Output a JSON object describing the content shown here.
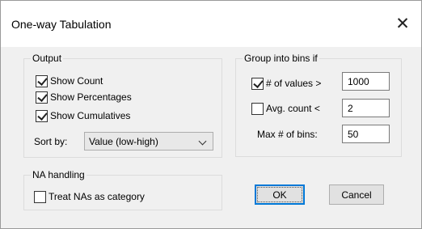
{
  "window": {
    "title": "One-way Tabulation",
    "close_glyph": "✕"
  },
  "output": {
    "legend": "Output",
    "show_count": {
      "label": "Show Count",
      "checked": true
    },
    "show_percentages": {
      "label": "Show Percentages",
      "checked": true
    },
    "show_cumulatives": {
      "label": "Show Cumulatives",
      "checked": true
    },
    "sort_by_label": "Sort by:",
    "sort_by_value": "Value (low-high)"
  },
  "bins": {
    "legend": "Group into bins if",
    "num_values": {
      "label": "# of values >",
      "checked": true,
      "value": "1000"
    },
    "avg_count": {
      "label": "Avg. count <",
      "checked": false,
      "value": "2"
    },
    "max_bins_label": "Max # of bins:",
    "max_bins_value": "50"
  },
  "na": {
    "legend": "NA handling",
    "treat_nas": {
      "label": "Treat NAs as category",
      "checked": false
    }
  },
  "buttons": {
    "ok": "OK",
    "cancel": "Cancel"
  },
  "colors": {
    "dialog_bg": "#f0f0f0",
    "default_button_border": "#0078d7"
  }
}
